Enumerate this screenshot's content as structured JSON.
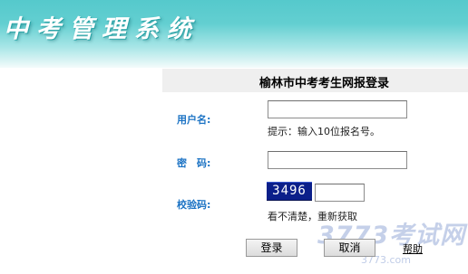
{
  "header": {
    "banner_title": "中考管理系统"
  },
  "form": {
    "title": "榆林市中考考生网报登录",
    "username_label": "用户名:",
    "username_value": "",
    "username_hint": "提示：输入10位报名号。",
    "password_label": "密　码:",
    "password_value": "",
    "captcha_label": "校验码:",
    "captcha_image_text": "3496",
    "captcha_value": "",
    "refresh_text": "看不清楚，重新获取"
  },
  "actions": {
    "login_label": "登录",
    "cancel_label": "取消",
    "help_label": "帮助"
  },
  "watermark": {
    "logo_text": "3773考试网",
    "url_text": "3773.com"
  },
  "colors": {
    "banner": "#55c9cc",
    "label": "#1c73c4",
    "captcha_bg": "#0b1f8a"
  }
}
